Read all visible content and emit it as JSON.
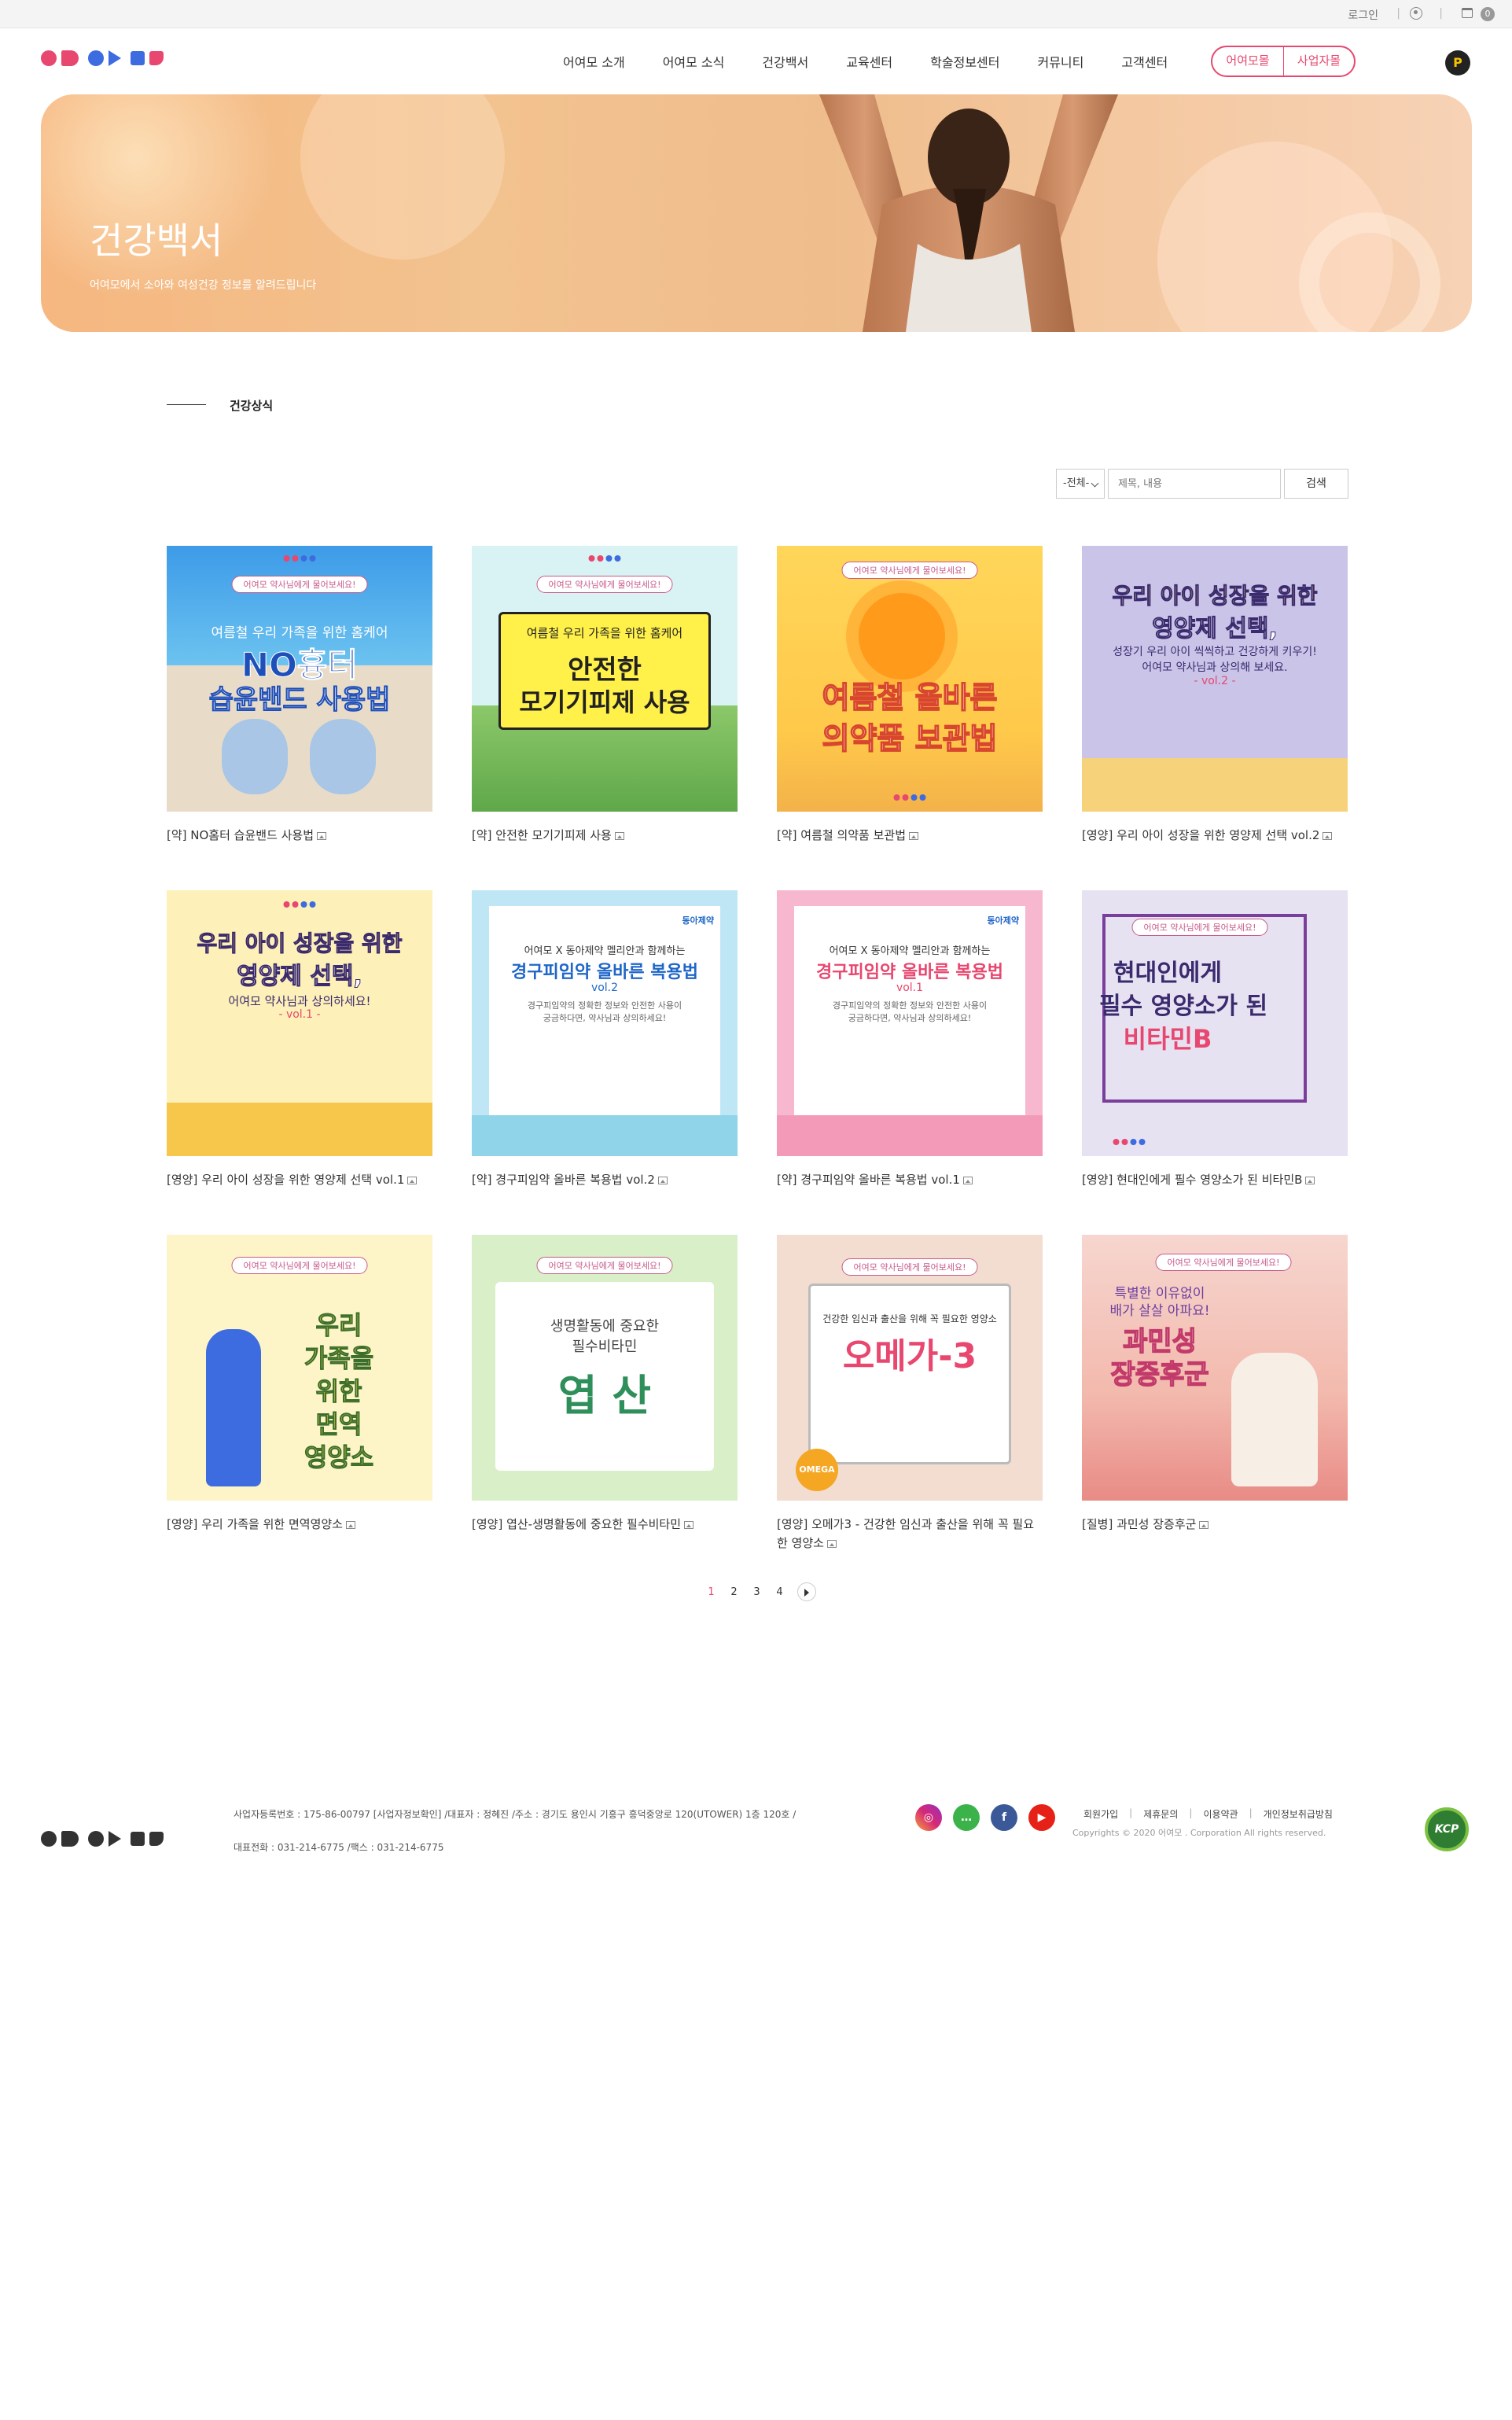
{
  "util": {
    "login": "로그인",
    "cart_count": "0"
  },
  "brand": {
    "pink": "#e8476f",
    "blue": "#3d6be0"
  },
  "nav": {
    "items": [
      "어여모 소개",
      "어여모 소식",
      "건강백서",
      "교육센터",
      "학술정보센터",
      "커뮤니티",
      "고객센터"
    ],
    "btn_user": "어여모몰",
    "btn_biz": "사업자몰",
    "point_icon": "P"
  },
  "hero": {
    "title": "건강백서",
    "subtitle": "어여모에서 소아와 여성건강 정보를 알려드립니다"
  },
  "section": {
    "title": "건강상식"
  },
  "search": {
    "select_value": "-전체-",
    "placeholder": "제목, 내용",
    "button": "검색"
  },
  "cards": [
    {
      "caption": "[약] NO홈터 습윤밴드 사용법",
      "badge": "어여모 약사님에게 물어보세요!",
      "line1": "여름철 우리 가족을 위한 홈케어",
      "big1": "NO흉터",
      "big2": "습윤밴드 사용법"
    },
    {
      "caption": "[약] 안전한 모기기피제 사용",
      "badge": "어여모 약사님에게 물어보세요!",
      "line1": "여름철 우리 가족을 위한 홈케어",
      "big1": "안전한",
      "big2": "모기기피제 사용"
    },
    {
      "caption": "[약] 여름철 의약품 보관법",
      "badge": "어여모 약사님에게 물어보세요!",
      "big1": "여름철 올바른",
      "big2": "의약품 보관법"
    },
    {
      "caption": "[영양] 우리 아이 성장을 위한 영양제 선택 vol.2",
      "big1": "우리 아이 성장을 위한",
      "big2": "영양제 선택,",
      "line1": "성장기 우리 아이 씩씩하고 건강하게 키우기!",
      "line2": "어여모 약사님과 상의해 보세요.",
      "line3": "- vol.2 -"
    },
    {
      "caption": "[영양] 우리 아이 성장을 위한 영양제 선택 vol.1",
      "big1": "우리 아이 성장을 위한",
      "big2": "영양제 선택,",
      "line1": "어여모 약사님과 상의하세요!",
      "line2": "- vol.1 -"
    },
    {
      "caption": "[약] 경구피임약 올바른 복용법 vol.2",
      "brand_tag": "동아제약",
      "line1": "어여모 X 동아제약 멜리안과 함께하는",
      "big1": "경구피임약 올바른 복용법",
      "line2": "vol.2",
      "line3": "경구피임약의 정확한 정보와 안전한 사용이",
      "line4": "궁금하다면, 약사님과 상의하세요!"
    },
    {
      "caption": "[약] 경구피임약 올바른 복용법 vol.1",
      "brand_tag": "동아제약",
      "line1": "어여모 X 동아제약 멜리안과 함께하는",
      "big1": "경구피임약 올바른 복용법",
      "line2": "vol.1",
      "line3": "경구피임약의 정확한 정보와 안전한 사용이",
      "line4": "궁금하다면, 약사님과 상의하세요!"
    },
    {
      "caption": "[영양] 현대인에게 필수 영양소가 된 비타민B",
      "badge": "어여모 약사님에게 물어보세요!",
      "big1": "현대인에게",
      "big2": "필수 영양소가 된",
      "big3": "비타민B"
    },
    {
      "caption": "[영양] 우리 가족을 위한 면역영양소",
      "badge": "어여모 약사님에게 물어보세요!",
      "big1": "우리",
      "big2": "가족을",
      "big3": "위한",
      "big4": "면역",
      "big5": "영양소"
    },
    {
      "caption": "[영양] 엽산-생명활동에 중요한 필수비타민",
      "badge": "어여모 약사님에게 물어보세요!",
      "line1": "생명활동에 중요한",
      "line2": "필수비타민",
      "big1": "엽 산"
    },
    {
      "caption": "[영양] 오메가3 - 건강한 임신과 출산을 위해 꼭 필요한 영양소",
      "badge": "어여모 약사님에게 물어보세요!",
      "line1": "건강한 임신과 출산을 위해 꼭 필요한 영양소",
      "big1": "오메가-3",
      "tag": "OMEGA 3"
    },
    {
      "caption": "[질병] 과민성 장증후군",
      "badge": "어여모 약사님에게 물어보세요!",
      "line1": "특별한 이유없이",
      "line2": "배가 살살 아파요!",
      "big1": "과민성",
      "big2": "장증후군"
    }
  ],
  "pagination": {
    "pages": [
      "1",
      "2",
      "3",
      "4"
    ],
    "current": "1"
  },
  "footer": {
    "info1": "사업자등록번호 : 175-86-00797 [사업자정보확인] /대표자 : 정혜진 /주소 : 경기도 용인시 기흥구 흥덕중앙로 120(UTOWER) 1층 120호 /",
    "info2": "대표전화 : 031-214-6775 /팩스 : 031-214-6775",
    "links": [
      "회원가입",
      "제휴문의",
      "이용약관",
      "개인정보취급방침"
    ],
    "copyright": "Copyrights © 2020 어여모 . Corporation All rights reserved.",
    "sns": [
      "instagram-icon",
      "talk-icon",
      "facebook-icon",
      "youtube-icon"
    ],
    "kcp": "KCP"
  }
}
